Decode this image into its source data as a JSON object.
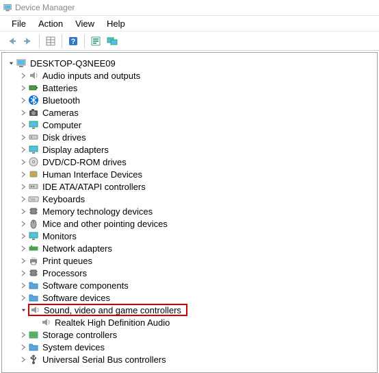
{
  "window": {
    "title": "Device Manager"
  },
  "menu": {
    "file": "File",
    "action": "Action",
    "view": "View",
    "help": "Help"
  },
  "tree": {
    "root": "DESKTOP-Q3NEE09",
    "categories": [
      {
        "id": "audio",
        "label": "Audio inputs and outputs"
      },
      {
        "id": "batteries",
        "label": "Batteries"
      },
      {
        "id": "bluetooth",
        "label": "Bluetooth"
      },
      {
        "id": "cameras",
        "label": "Cameras"
      },
      {
        "id": "computer",
        "label": "Computer"
      },
      {
        "id": "disk",
        "label": "Disk drives"
      },
      {
        "id": "display",
        "label": "Display adapters"
      },
      {
        "id": "dvd",
        "label": "DVD/CD-ROM drives"
      },
      {
        "id": "hid",
        "label": "Human Interface Devices"
      },
      {
        "id": "ide",
        "label": "IDE ATA/ATAPI controllers"
      },
      {
        "id": "keyboards",
        "label": "Keyboards"
      },
      {
        "id": "memtech",
        "label": "Memory technology devices"
      },
      {
        "id": "mice",
        "label": "Mice and other pointing devices"
      },
      {
        "id": "monitors",
        "label": "Monitors"
      },
      {
        "id": "network",
        "label": "Network adapters"
      },
      {
        "id": "printq",
        "label": "Print queues"
      },
      {
        "id": "processors",
        "label": "Processors"
      },
      {
        "id": "swcomp",
        "label": "Software components"
      },
      {
        "id": "swdev",
        "label": "Software devices"
      },
      {
        "id": "sound",
        "label": "Sound, video and game controllers",
        "expanded": true,
        "highlighted": true,
        "children": [
          {
            "id": "realtek",
            "label": "Realtek High Definition Audio"
          }
        ]
      },
      {
        "id": "storage",
        "label": "Storage controllers"
      },
      {
        "id": "system",
        "label": "System devices"
      },
      {
        "id": "usb",
        "label": "Universal Serial Bus controllers"
      }
    ]
  }
}
